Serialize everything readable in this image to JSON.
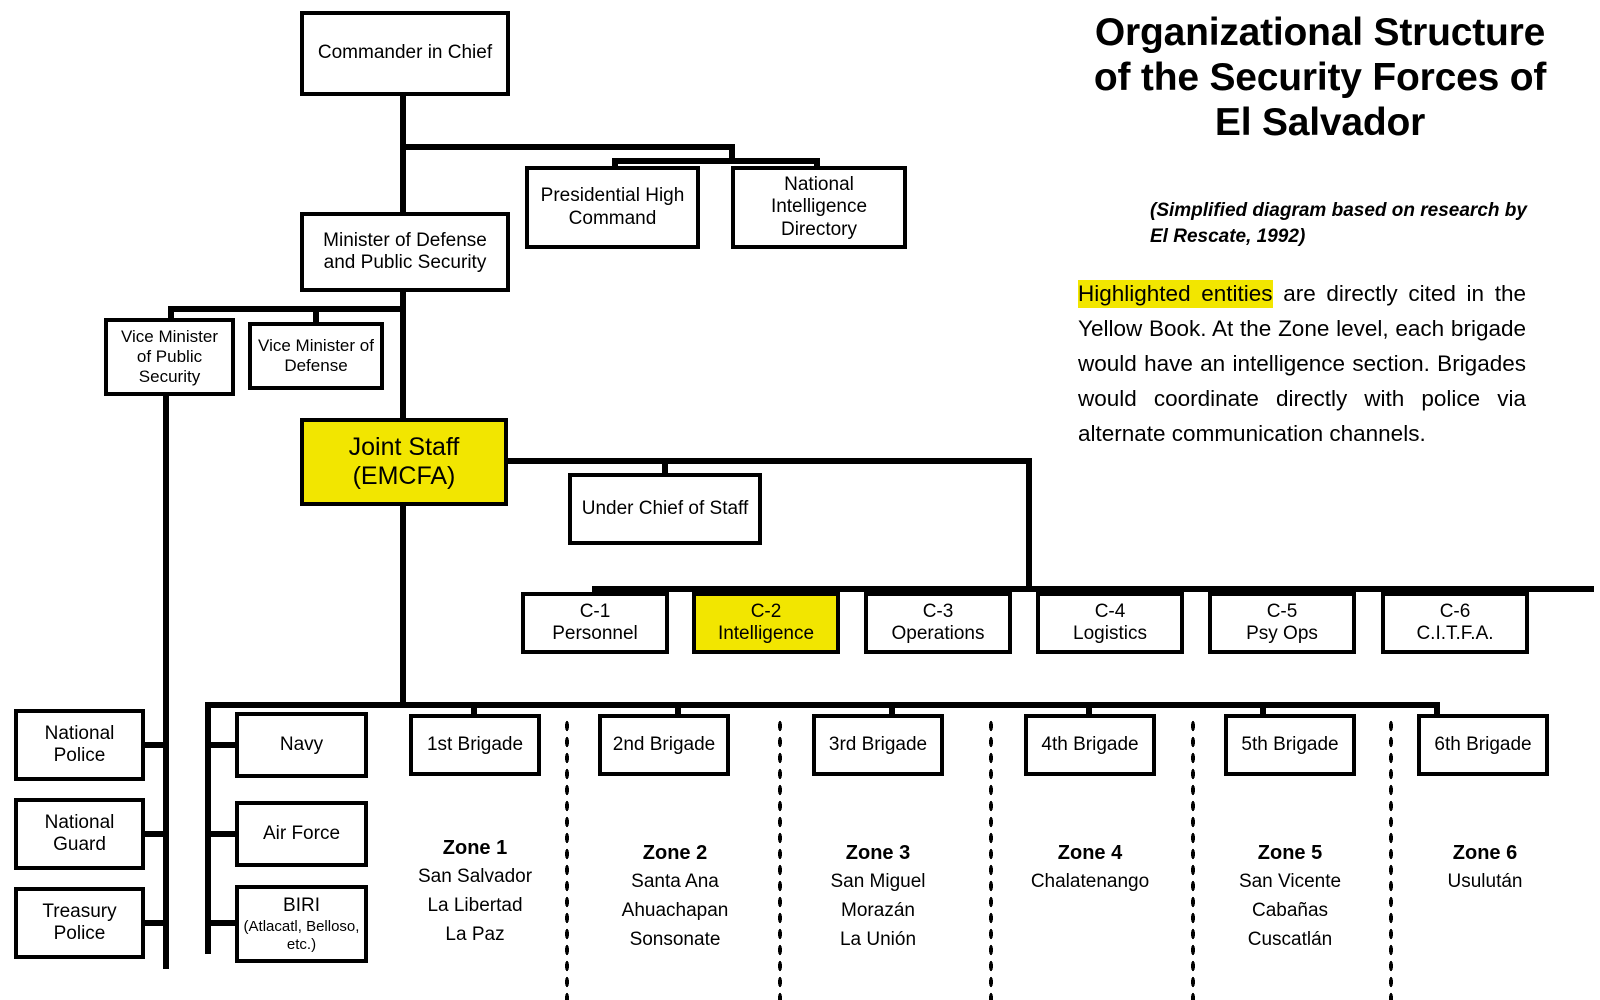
{
  "header": {
    "title": "Organizational Structure of the Security Forces of El Salvador",
    "title_line1": "Organizational Structure",
    "title_line2": "of the Security Forces of",
    "title_line3": "El Salvador",
    "subtitle": "(Simplified diagram based on research by El Rescate, 1992)",
    "note_highlight": "Highlighted entities",
    "note_rest": " are directly cited in the Yellow Book. At the Zone level, each brigade would have an intelligence section. Brigades would coordinate directly with police via alternate communication channels."
  },
  "colors": {
    "highlight": "#F2E600",
    "line": "#000000",
    "background": "#FFFFFF"
  },
  "nodes": {
    "commander_in_chief": "Commander in Chief",
    "presidential_high_command": "Presidential High Command",
    "national_intelligence_directory": "National Intelligence Directory",
    "minister_of_defense": "Minister of Defense and Public Security",
    "vice_minister_public_security": "Vice Minister of Public Security",
    "vice_minister_defense": "Vice Minister of Defense",
    "joint_staff": "Joint Staff (EMCFA)",
    "joint_staff_line1": "Joint Staff",
    "joint_staff_line2": "(EMCFA)",
    "under_chief_of_staff": "Under Chief of Staff",
    "navy": "Navy",
    "air_force": "Air Force",
    "biri_title": "BIRI",
    "biri_sub": "(Atlacatl, Belloso, etc.)",
    "national_police": "National Police",
    "national_guard": "National Guard",
    "treasury_police": "Treasury Police"
  },
  "staff_sections": [
    {
      "code": "C-1",
      "name": "Personnel",
      "highlighted": false
    },
    {
      "code": "C-2",
      "name": "Intelligence",
      "highlighted": true
    },
    {
      "code": "C-3",
      "name": "Operations",
      "highlighted": false
    },
    {
      "code": "C-4",
      "name": "Logistics",
      "highlighted": false
    },
    {
      "code": "C-5",
      "name": "Psy Ops",
      "highlighted": false
    },
    {
      "code": "C-6",
      "name": "C.I.T.F.A.",
      "highlighted": false
    }
  ],
  "brigades": [
    {
      "box": "1st Brigade",
      "zone": "Zone 1",
      "departments": "San Salvador\nLa Libertad\nLa Paz"
    },
    {
      "box": "2nd Brigade",
      "zone": "Zone 2",
      "departments": "Santa Ana\nAhuachapan\nSonsonate"
    },
    {
      "box": "3rd Brigade",
      "zone": "Zone 3",
      "departments": "San Miguel\nMorazán\nLa Unión"
    },
    {
      "box": "4th Brigade",
      "zone": "Zone 4",
      "departments": "Chalatenango"
    },
    {
      "box": "5th Brigade",
      "zone": "Zone 5",
      "departments": "San Vicente\nCabañas\nCuscatlán"
    },
    {
      "box": "6th Brigade",
      "zone": "Zone 6",
      "departments": "Usulután"
    }
  ]
}
